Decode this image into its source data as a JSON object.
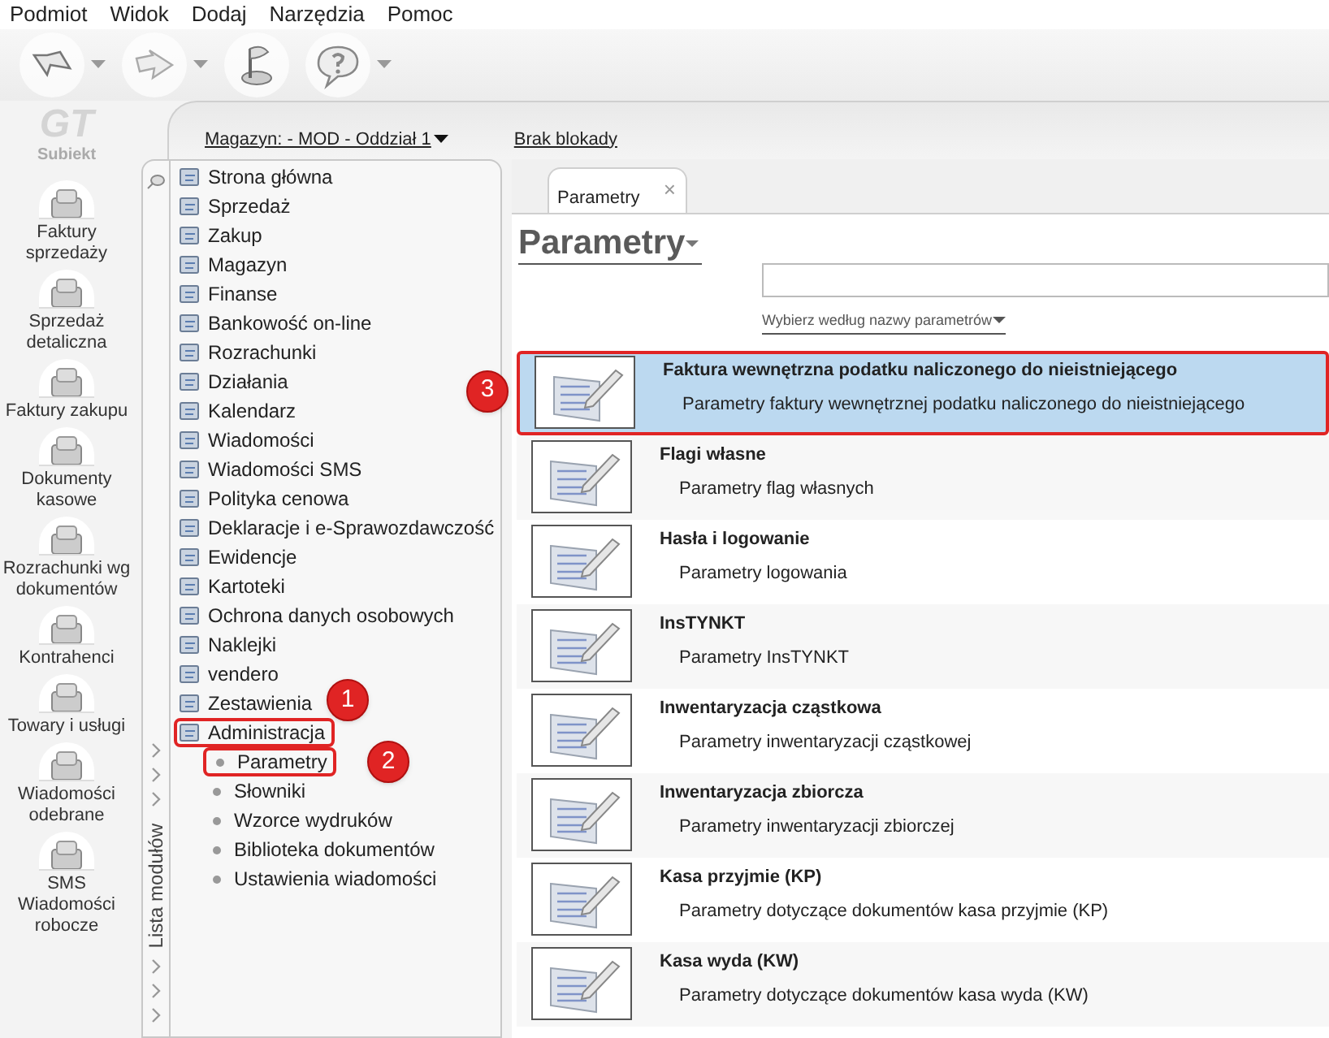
{
  "menu": [
    "Podmiot",
    "Widok",
    "Dodaj",
    "Narzędzia",
    "Pomoc"
  ],
  "toolbar": [
    {
      "kind": "back",
      "dropdown": true
    },
    {
      "kind": "forward",
      "dropdown": true
    },
    {
      "kind": "flag",
      "dropdown": false
    },
    {
      "kind": "help",
      "dropdown": true
    }
  ],
  "logo": {
    "mark": "GT",
    "name": "Subiekt"
  },
  "nav": [
    {
      "label": "Faktury sprzedaży"
    },
    {
      "label": "Sprzedaż detaliczna"
    },
    {
      "label": "Faktury zakupu"
    },
    {
      "label": "Dokumenty kasowe"
    },
    {
      "label": "Rozrachunki wg dokumentów"
    },
    {
      "label": "Kontrahenci"
    },
    {
      "label": "Towary i usługi"
    },
    {
      "label": "Wiadomości odebrane"
    },
    {
      "label": "SMS Wiadomości robocze"
    }
  ],
  "header": {
    "warehouse": "Magazyn: - MOD - Oddział 1",
    "lock": "Brak blokady"
  },
  "module_panel": {
    "title": "Lista modułów",
    "items": [
      {
        "label": "Strona główna"
      },
      {
        "label": "Sprzedaż"
      },
      {
        "label": "Zakup"
      },
      {
        "label": "Magazyn"
      },
      {
        "label": "Finanse"
      },
      {
        "label": "Bankowość on-line"
      },
      {
        "label": "Rozrachunki"
      },
      {
        "label": "Działania"
      },
      {
        "label": "Kalendarz"
      },
      {
        "label": "Wiadomości"
      },
      {
        "label": "Wiadomości SMS"
      },
      {
        "label": "Polityka cenowa"
      },
      {
        "label": "Deklaracje i e-Sprawozdawczość"
      },
      {
        "label": "Ewidencje"
      },
      {
        "label": "Kartoteki"
      },
      {
        "label": "Ochrona danych osobowych"
      },
      {
        "label": "Naklejki"
      },
      {
        "label": "vendero"
      },
      {
        "label": "Zestawienia"
      },
      {
        "label": "Administracja",
        "expanded": true,
        "annotation": "1",
        "children": [
          {
            "label": "Parametry",
            "annotation": "2"
          },
          {
            "label": "Słowniki"
          },
          {
            "label": "Wzorce wydruków"
          },
          {
            "label": "Biblioteka dokumentów"
          },
          {
            "label": "Ustawienia wiadomości"
          }
        ]
      }
    ]
  },
  "tabs": [
    {
      "label": "Parametry",
      "selected": true,
      "close": "×"
    }
  ],
  "page": {
    "title": "Parametry",
    "search": {
      "kind": "field"
    },
    "filter": "Wybierz według nazwy parametrów"
  },
  "parameters": [
    {
      "title": "Faktura wewnętrzna podatku naliczonego do nieistniejącego",
      "description": "Parametry faktury wewnętrznej podatku naliczonego do nieistniejącego",
      "selected": true,
      "annotation": "3"
    },
    {
      "title": "Flagi własne",
      "description": "Parametry flag własnych",
      "selected": false
    },
    {
      "title": "Hasła i logowanie",
      "description": "Parametry logowania",
      "selected": false
    },
    {
      "title": "InsTYNKT",
      "description": "Parametry InsTYNKT",
      "selected": false
    },
    {
      "title": "Inwentaryzacja cząstkowa",
      "description": "Parametry inwentaryzacji cząstkowej",
      "selected": false
    },
    {
      "title": "Inwentaryzacja zbiorcza",
      "description": "Parametry inwentaryzacji zbiorczej",
      "selected": false
    },
    {
      "title": "Kasa przyjmie (KP)",
      "description": "Parametry dotyczące dokumentów kasa przyjmie (KP)",
      "selected": false
    },
    {
      "title": "Kasa wyda (KW)",
      "description": "Parametry dotyczące dokumentów kasa wyda (KW)",
      "selected": false
    }
  ]
}
